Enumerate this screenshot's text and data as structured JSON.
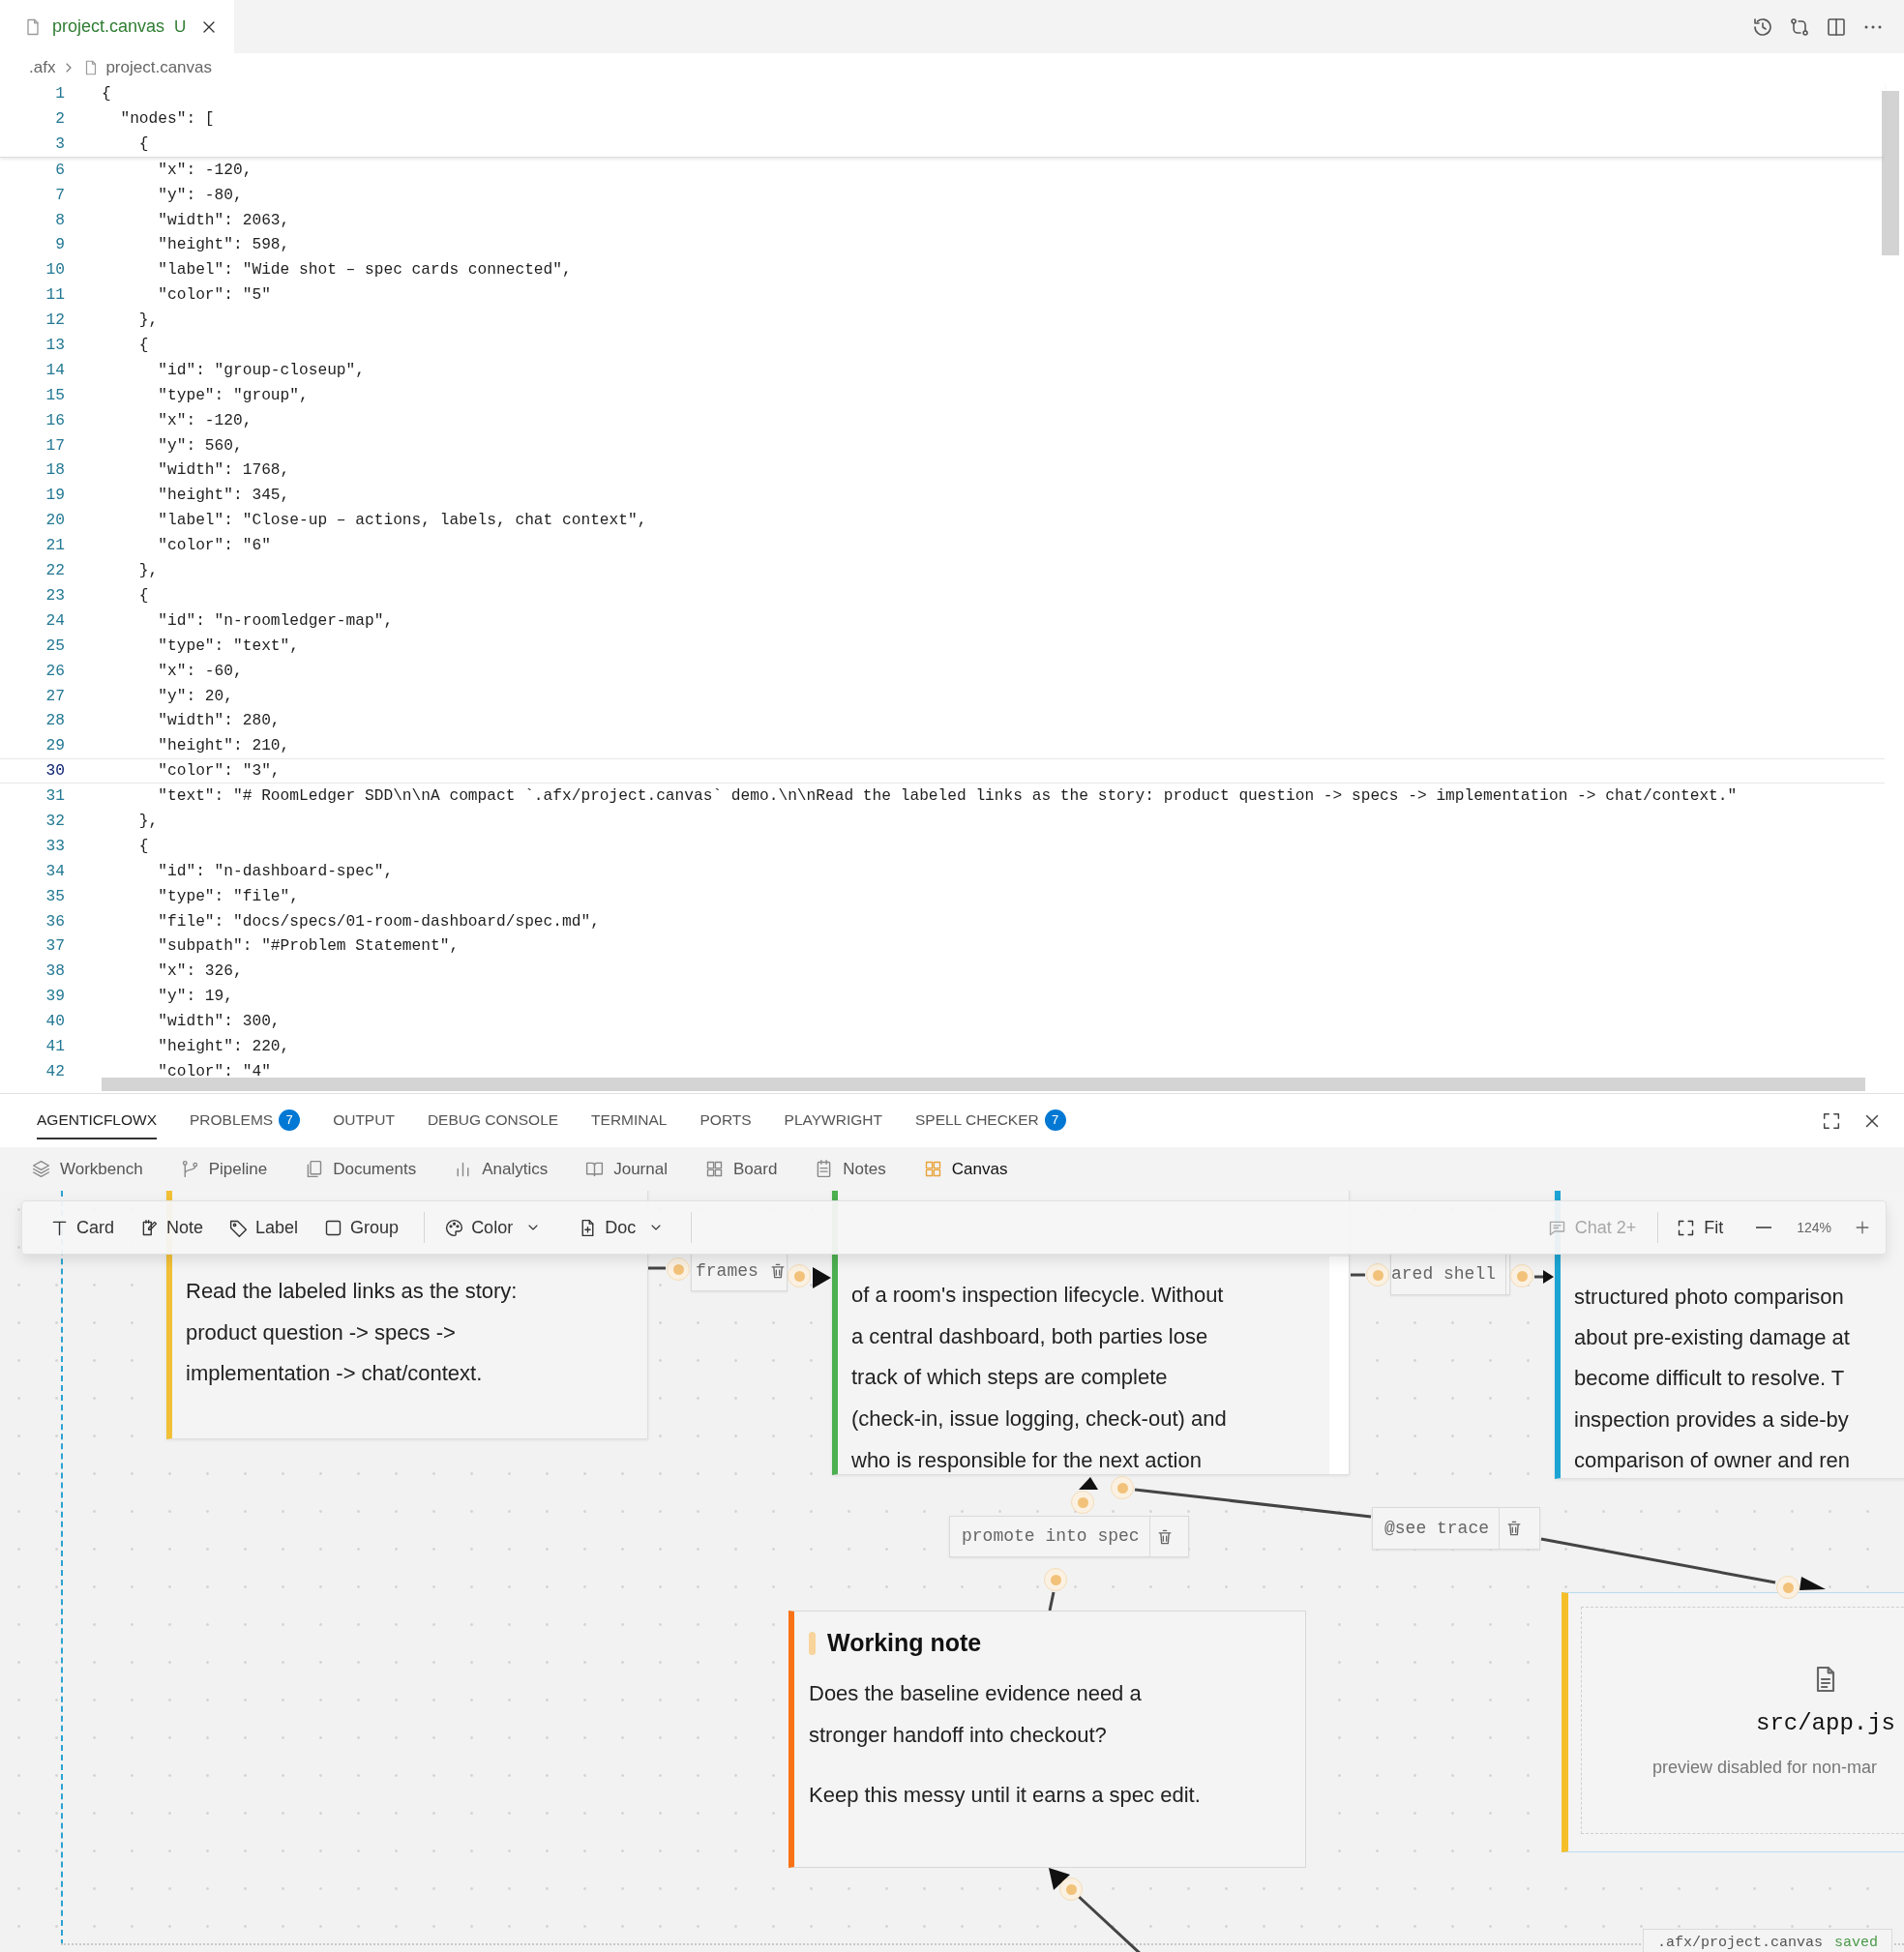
{
  "editor_tab": {
    "title": "project.canvas",
    "git_status": "U"
  },
  "breadcrumb": [
    ".afx",
    "project.canvas"
  ],
  "code": {
    "sticky_lines": [
      {
        "number": "1",
        "text": "{",
        "current": false
      },
      {
        "number": "2",
        "text": "  \"nodes\": [",
        "current": false
      },
      {
        "number": "3",
        "text": "    {",
        "current": false
      }
    ],
    "lines": [
      {
        "number": "6",
        "text": "      \"x\": -120,",
        "current": false
      },
      {
        "number": "7",
        "text": "      \"y\": -80,",
        "current": false
      },
      {
        "number": "8",
        "text": "      \"width\": 2063,",
        "current": false
      },
      {
        "number": "9",
        "text": "      \"height\": 598,",
        "current": false
      },
      {
        "number": "10",
        "text": "      \"label\": \"Wide shot – spec cards connected\",",
        "current": false
      },
      {
        "number": "11",
        "text": "      \"color\": \"5\"",
        "current": false
      },
      {
        "number": "12",
        "text": "    },",
        "current": false
      },
      {
        "number": "13",
        "text": "    {",
        "current": false
      },
      {
        "number": "14",
        "text": "      \"id\": \"group-closeup\",",
        "current": false
      },
      {
        "number": "15",
        "text": "      \"type\": \"group\",",
        "current": false
      },
      {
        "number": "16",
        "text": "      \"x\": -120,",
        "current": false
      },
      {
        "number": "17",
        "text": "      \"y\": 560,",
        "current": false
      },
      {
        "number": "18",
        "text": "      \"width\": 1768,",
        "current": false
      },
      {
        "number": "19",
        "text": "      \"height\": 345,",
        "current": false
      },
      {
        "number": "20",
        "text": "      \"label\": \"Close-up – actions, labels, chat context\",",
        "current": false
      },
      {
        "number": "21",
        "text": "      \"color\": \"6\"",
        "current": false
      },
      {
        "number": "22",
        "text": "    },",
        "current": false
      },
      {
        "number": "23",
        "text": "    {",
        "current": false
      },
      {
        "number": "24",
        "text": "      \"id\": \"n-roomledger-map\",",
        "current": false
      },
      {
        "number": "25",
        "text": "      \"type\": \"text\",",
        "current": false
      },
      {
        "number": "26",
        "text": "      \"x\": -60,",
        "current": false
      },
      {
        "number": "27",
        "text": "      \"y\": 20,",
        "current": false
      },
      {
        "number": "28",
        "text": "      \"width\": 280,",
        "current": false
      },
      {
        "number": "29",
        "text": "      \"height\": 210,",
        "current": false
      },
      {
        "number": "30",
        "text": "      \"color\": \"3\",",
        "current": true
      },
      {
        "number": "31",
        "text": "      \"text\": \"# RoomLedger SDD\\n\\nA compact `.afx/project.canvas` demo.\\n\\nRead the labeled links as the story: product question -> specs -> implementation -> chat/context.\"",
        "current": false
      },
      {
        "number": "32",
        "text": "    },",
        "current": false
      },
      {
        "number": "33",
        "text": "    {",
        "current": false
      },
      {
        "number": "34",
        "text": "      \"id\": \"n-dashboard-spec\",",
        "current": false
      },
      {
        "number": "35",
        "text": "      \"type\": \"file\",",
        "current": false
      },
      {
        "number": "36",
        "text": "      \"file\": \"docs/specs/01-room-dashboard/spec.md\",",
        "current": false
      },
      {
        "number": "37",
        "text": "      \"subpath\": \"#Problem Statement\",",
        "current": false
      },
      {
        "number": "38",
        "text": "      \"x\": 326,",
        "current": false
      },
      {
        "number": "39",
        "text": "      \"y\": 19,",
        "current": false
      },
      {
        "number": "40",
        "text": "      \"width\": 300,",
        "current": false
      },
      {
        "number": "41",
        "text": "      \"height\": 220,",
        "current": false
      },
      {
        "number": "42",
        "text": "      \"color\": \"4\"",
        "current": false
      }
    ]
  },
  "panel_tabs": [
    {
      "label": "AGENTICFLOWX",
      "selected": true
    },
    {
      "label": "PROBLEMS",
      "badge": "7",
      "selected": false
    },
    {
      "label": "OUTPUT",
      "selected": false
    },
    {
      "label": "DEBUG CONSOLE",
      "selected": false
    },
    {
      "label": "TERMINAL",
      "selected": false
    },
    {
      "label": "PORTS",
      "selected": false
    },
    {
      "label": "PLAYWRIGHT",
      "selected": false
    },
    {
      "label": "SPELL CHECKER",
      "badge": "7",
      "selected": false
    }
  ],
  "view_tabs": [
    {
      "label": "Workbench",
      "selected": false
    },
    {
      "label": "Pipeline",
      "selected": false
    },
    {
      "label": "Documents",
      "selected": false
    },
    {
      "label": "Analytics",
      "selected": false
    },
    {
      "label": "Journal",
      "selected": false
    },
    {
      "label": "Board",
      "selected": false
    },
    {
      "label": "Notes",
      "selected": false
    },
    {
      "label": "Canvas",
      "selected": true
    }
  ],
  "toolbar": {
    "tools": [
      {
        "label": "Card",
        "dropdown": false
      },
      {
        "label": "Note",
        "dropdown": false
      },
      {
        "label": "Label",
        "dropdown": false
      },
      {
        "label": "Group",
        "dropdown": false
      },
      {
        "label": "Color",
        "dropdown": true
      },
      {
        "label": "Doc",
        "dropdown": true
      }
    ],
    "chat": {
      "label": "Chat 2+",
      "disabled": true
    },
    "fit": "Fit",
    "zoom": "124%"
  },
  "canvas": {
    "cards": [
      {
        "color": "#f2c037",
        "paragraphs": [
          [
            "Read the labeled links as the story:",
            "product question -> specs ->",
            "implementation -> chat/context."
          ]
        ]
      },
      {
        "color": "#4caf50",
        "paragraphs": [
          [
            "of a room's inspection lifecycle. Without",
            "a central dashboard, both parties lose",
            "track of which steps are complete",
            "(check-in, issue logging, check-out) and",
            "who is responsible for the next action"
          ]
        ]
      },
      {
        "color": "#1ba4d3",
        "paragraphs": [
          [
            "structured photo comparison",
            "about pre-existing damage at",
            "become difficult to resolve. T",
            "inspection provides a side-by",
            "comparison of owner and ren"
          ]
        ]
      }
    ],
    "note": {
      "title": "Working note",
      "color": "#f97316",
      "paragraphs": [
        [
          "Does the baseline evidence need a",
          "stronger handoff into checkout?"
        ],
        [
          "Keep this messy until it earns a spec edit."
        ]
      ]
    },
    "file_card": {
      "path": "src/app.js",
      "message": "preview disabled for non-mar",
      "color": "#f5bf2a"
    },
    "edge_labels": [
      {
        "text": "frames",
        "delete_button": true
      },
      {
        "text": "ared shell",
        "delete_button": false
      },
      {
        "text": "promote into spec",
        "delete_button": true
      },
      {
        "text": "@see trace",
        "delete_button": true
      }
    ],
    "status": {
      "file": ".afx/project.canvas",
      "state": "saved"
    }
  }
}
